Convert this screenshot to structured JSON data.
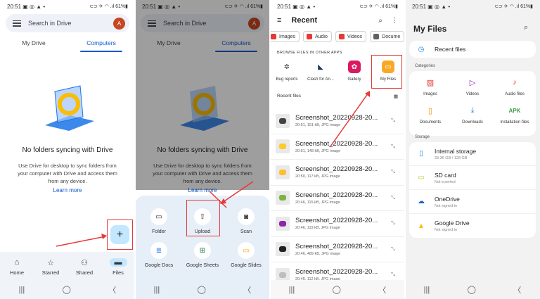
{
  "status": {
    "time": "20:51",
    "indicators": "▣ ◎ ▲ •",
    "right": "⊂⊃ ✈ ◠ .ıl 61%▮"
  },
  "sysnav": {
    "recents": "|||",
    "home": "◯",
    "back": "〈"
  },
  "panel1": {
    "search_placeholder": "Search in Drive",
    "avatar_letter": "A",
    "tabs": [
      {
        "label": "My Drive"
      },
      {
        "label": "Computers"
      }
    ],
    "empty_title": "No folders syncing with Drive",
    "empty_body": "Use Drive for desktop to sync folders from your computer with Drive and access them from any device.",
    "learn_more": "Learn more",
    "fab_label": "+",
    "nav": [
      {
        "label": "Home",
        "icon": "⌂"
      },
      {
        "label": "Starred",
        "icon": "☆"
      },
      {
        "label": "Shared",
        "icon": "⚇"
      },
      {
        "label": "Files",
        "icon": "▬"
      }
    ]
  },
  "panel2": {
    "sheet": [
      {
        "label": "Folder",
        "icon": "▭"
      },
      {
        "label": "Upload",
        "icon": "⇧"
      },
      {
        "label": "Scan",
        "icon": "◙"
      },
      {
        "label": "Google Docs",
        "icon": "≣"
      },
      {
        "label": "Google Sheets",
        "icon": "⊞"
      },
      {
        "label": "Google Slides",
        "icon": "▭"
      }
    ]
  },
  "panel3": {
    "title": "Recent",
    "search_icon": "⌕",
    "more_icon": "⋮",
    "menu_icon": "≡",
    "chips": [
      {
        "label": "Images",
        "color": "#e53935"
      },
      {
        "label": "Audio",
        "color": "#e53935"
      },
      {
        "label": "Videos",
        "color": "#e53935"
      },
      {
        "label": "Docume",
        "color": "#616161"
      }
    ],
    "browse_label": "BROWSE FILES IN OTHER APPS",
    "apps": [
      {
        "label": "Bug reports",
        "icon": "✲",
        "color": "#ffffff"
      },
      {
        "label": "Clash for An...",
        "icon": "◣",
        "color": "#ffffff"
      },
      {
        "label": "Gallery",
        "icon": "✿",
        "color": "#d81b60"
      },
      {
        "label": "My Files",
        "icon": "▭",
        "color": "#f9a825"
      }
    ],
    "recent_label": "Recent files",
    "grid_icon": "▦",
    "expand_icon": "⤡",
    "files": [
      {
        "name": "Screenshot_20220928-20...",
        "meta": "20:51, 151 kB, JPG image",
        "color": "#424242"
      },
      {
        "name": "Screenshot_20220928-20...",
        "meta": "20:51, 148 kB, JPG image",
        "color": "#ffca28"
      },
      {
        "name": "Screenshot_20220928-20...",
        "meta": "20:50, 117 kB, JPG image",
        "color": "#fbc02d"
      },
      {
        "name": "Screenshot_20220928-20...",
        "meta": "20:46, 115 kB, JPG image",
        "color": "#7cb342"
      },
      {
        "name": "Screenshot_20220928-20...",
        "meta": "20:46, 119 kB, JPG image",
        "color": "#8e24aa"
      },
      {
        "name": "Screenshot_20220928-20...",
        "meta": "20:46, 489 kB, JPG image",
        "color": "#212121"
      },
      {
        "name": "Screenshot_20220928-20...",
        "meta": "20:45, 112 kB, JPG image",
        "color": "#bdbdbd"
      }
    ]
  },
  "panel4": {
    "title": "My Files",
    "search_icon": "⌕",
    "recent_label": "Recent files",
    "recent_icon": "◷",
    "categories_label": "Categories",
    "categories": [
      {
        "label": "Images",
        "icon": "▨",
        "color": "#e53935"
      },
      {
        "label": "Videos",
        "icon": "▷",
        "color": "#8e24aa"
      },
      {
        "label": "Audio files",
        "icon": "♪",
        "color": "#e53935"
      },
      {
        "label": "Documents",
        "icon": "▯",
        "color": "#fb8c00"
      },
      {
        "label": "Downloads",
        "icon": "⤓",
        "color": "#1e88e5"
      },
      {
        "label": "Installation files",
        "icon": "APK",
        "color": "#43a047"
      }
    ],
    "storage_label": "Storage",
    "storage": [
      {
        "label": "Internal storage",
        "sub": "33.36 GB / 128 GB",
        "icon": "▯",
        "color": "#1e88e5"
      },
      {
        "label": "SD card",
        "sub": "Not inserted",
        "icon": "▭",
        "color": "#c0ca33"
      },
      {
        "label": "OneDrive",
        "sub": "Not signed in",
        "icon": "☁",
        "color": "#1565c0"
      },
      {
        "label": "Google Drive",
        "sub": "Not signed in",
        "icon": "▲",
        "color": "#fbbc04"
      }
    ]
  }
}
